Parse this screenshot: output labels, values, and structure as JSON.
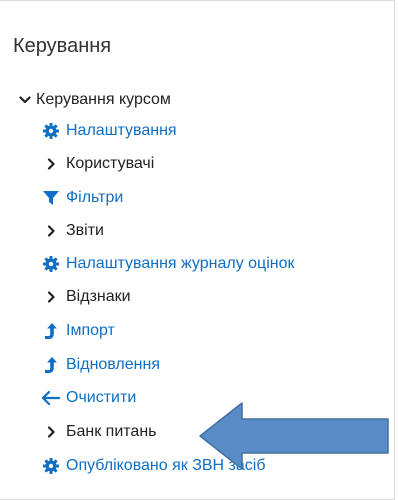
{
  "block": {
    "title": "Керування"
  },
  "tree": {
    "root": {
      "label": "Керування курсом",
      "icon": "chevron-down-icon"
    },
    "items": [
      {
        "label": "Налаштування",
        "icon": "gear-icon",
        "kind": "link"
      },
      {
        "label": "Користувачі",
        "icon": "chevron-right-icon",
        "kind": "plain"
      },
      {
        "label": "Фільтри",
        "icon": "filter-icon",
        "kind": "link"
      },
      {
        "label": "Звіти",
        "icon": "chevron-right-icon",
        "kind": "plain"
      },
      {
        "label": "Налаштування журналу оцінок",
        "icon": "gear-icon",
        "kind": "link"
      },
      {
        "label": "Відзнаки",
        "icon": "chevron-right-icon",
        "kind": "plain"
      },
      {
        "label": "Імпорт",
        "icon": "level-up-icon",
        "kind": "link"
      },
      {
        "label": "Відновлення",
        "icon": "level-up-icon",
        "kind": "link"
      },
      {
        "label": "Очистити",
        "icon": "arrow-left-icon",
        "kind": "link"
      },
      {
        "label": "Банк питань",
        "icon": "chevron-right-icon",
        "kind": "plain"
      },
      {
        "label": "Опубліковано як ЗВН засіб",
        "icon": "gear-icon",
        "kind": "link"
      }
    ]
  },
  "colors": {
    "link": "#0f6fc5",
    "text": "#222222",
    "annotation_arrow": "#5b8bc7"
  }
}
